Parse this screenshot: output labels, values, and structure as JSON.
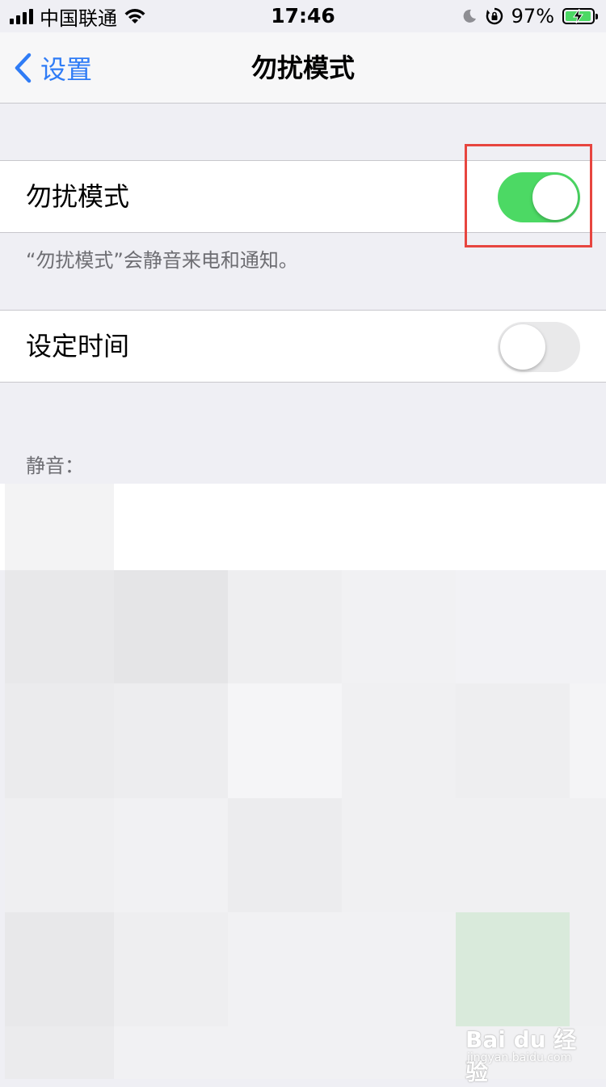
{
  "status_bar": {
    "carrier": "中国联通",
    "time": "17:46",
    "battery_percent": "97%",
    "battery_level": 0.97
  },
  "nav": {
    "back_label": "设置",
    "title": "勿扰模式"
  },
  "dnd": {
    "label": "勿扰模式",
    "enabled": true,
    "footer": "“勿扰模式”会静音来电和通知。"
  },
  "scheduled": {
    "label": "设定时间",
    "enabled": false
  },
  "silence": {
    "header": "静音："
  },
  "colors": {
    "accent_blue": "#2f7cf6",
    "toggle_on": "#4cd964",
    "toggle_off": "#e9e9ea",
    "background": "#efeff4",
    "highlight_red": "#e7453f"
  },
  "watermark": {
    "brand": "Bai du 经验",
    "site": "jingyan.baidu.com"
  }
}
